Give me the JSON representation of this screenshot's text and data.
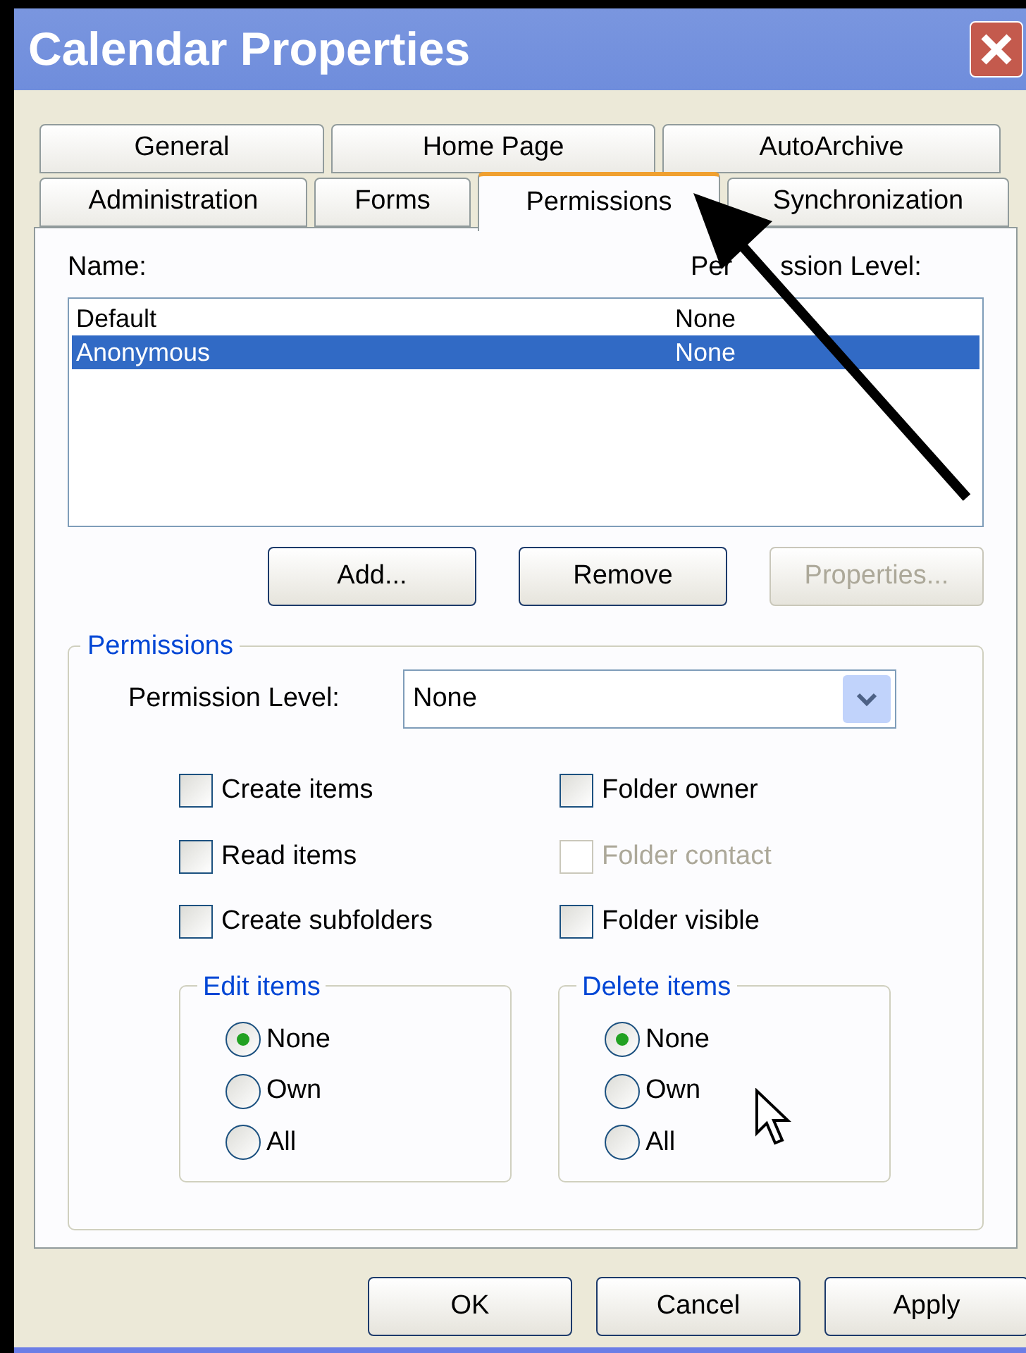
{
  "window": {
    "title": "Calendar Properties"
  },
  "tab_rows": [
    {
      "tabs": [
        {
          "label": "General",
          "selected": false
        },
        {
          "label": "Home Page",
          "selected": false
        },
        {
          "label": "AutoArchive",
          "selected": false
        }
      ]
    },
    {
      "tabs": [
        {
          "label": "Administration",
          "selected": false
        },
        {
          "label": "Forms",
          "selected": false
        },
        {
          "label": "Permissions",
          "selected": true
        },
        {
          "label": "Synchronization",
          "selected": false
        }
      ]
    }
  ],
  "list": {
    "header": {
      "name": "Name:",
      "level_visible_parts": [
        "Per",
        "ssion Level:"
      ]
    },
    "rows": [
      {
        "name": "Default",
        "level": "None",
        "selected": false
      },
      {
        "name": "Anonymous",
        "level": "None",
        "selected": true
      }
    ]
  },
  "list_buttons": [
    {
      "label": "Add...",
      "disabled": false
    },
    {
      "label": "Remove",
      "disabled": false
    },
    {
      "label": "Properties...",
      "disabled": true
    }
  ],
  "permissions": {
    "title": "Permissions",
    "level_label": "Permission Level:",
    "level_value": "None",
    "checkboxes": [
      {
        "label": "Create items",
        "checked": false,
        "disabled": false
      },
      {
        "label": "Folder owner",
        "checked": false,
        "disabled": false
      },
      {
        "label": "Read items",
        "checked": false,
        "disabled": false
      },
      {
        "label": "Folder contact",
        "checked": false,
        "disabled": true
      },
      {
        "label": "Create subfolders",
        "checked": false,
        "disabled": false
      },
      {
        "label": "Folder visible",
        "checked": false,
        "disabled": false
      }
    ],
    "radio_groups": [
      {
        "title": "Edit items",
        "options": [
          {
            "label": "None",
            "selected": true
          },
          {
            "label": "Own",
            "selected": false
          },
          {
            "label": "All",
            "selected": false
          }
        ]
      },
      {
        "title": "Delete items",
        "options": [
          {
            "label": "None",
            "selected": true
          },
          {
            "label": "Own",
            "selected": false
          },
          {
            "label": "All",
            "selected": false
          }
        ]
      }
    ]
  },
  "dialog_buttons": [
    "OK",
    "Cancel",
    "Apply"
  ]
}
